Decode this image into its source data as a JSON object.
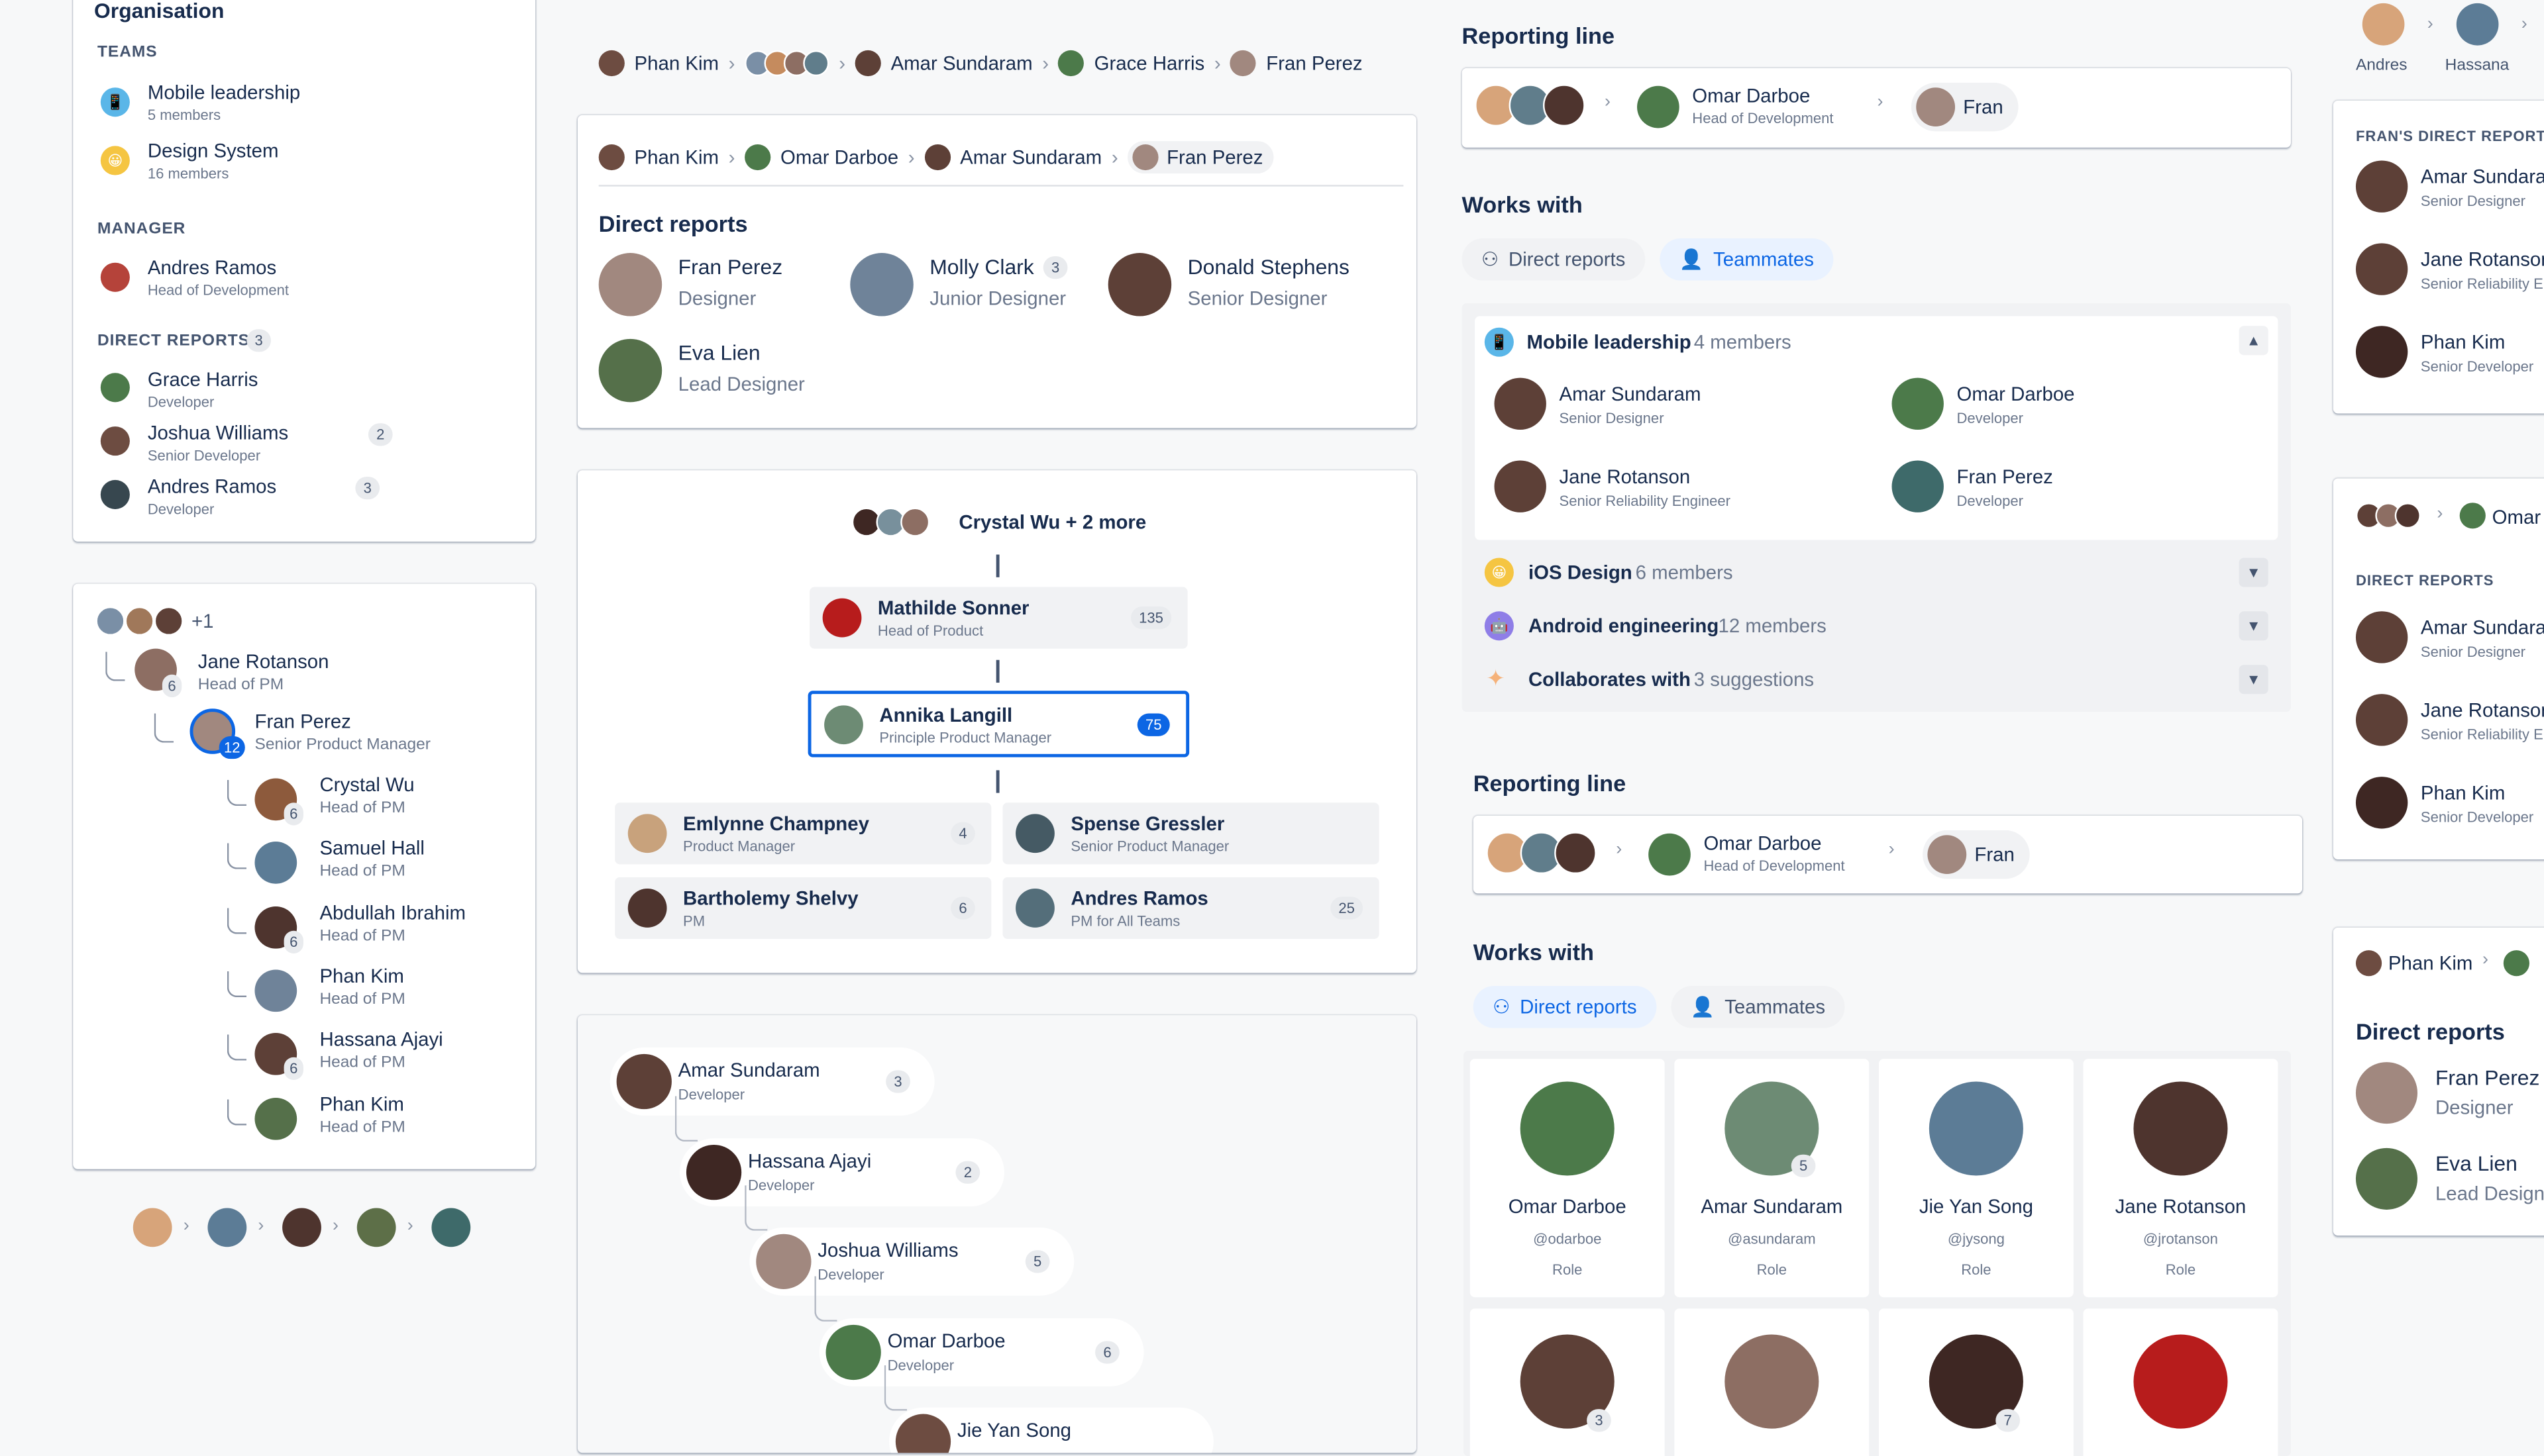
{
  "colors": {
    "accent": "#0c66e4",
    "text": "#172b4d",
    "subtle": "#6b778c"
  },
  "left_card": {
    "title": "Organisation",
    "teams_label": "TEAMS",
    "teams": [
      {
        "name": "Mobile leadership",
        "meta": "5 members"
      },
      {
        "name": "Design System",
        "meta": "16 members"
      }
    ],
    "manager_label": "MANAGER",
    "manager": {
      "name": "Andres Ramos",
      "role": "Head of Development"
    },
    "direct_reports_label": "DIRECT REPORTS",
    "direct_reports_count": "3",
    "direct_reports": [
      {
        "name": "Grace Harris",
        "role": "Developer",
        "count": ""
      },
      {
        "name": "Joshua Williams",
        "role": "Senior Developer",
        "count": "2"
      },
      {
        "name": "Andres Ramos",
        "role": "Developer",
        "count": "3"
      }
    ]
  },
  "tree_card": {
    "more": "+1",
    "root": {
      "name": "Jane Rotanson",
      "role": "Head of PM",
      "count": "6"
    },
    "sub": {
      "name": "Fran Perez",
      "role": "Senior Product Manager",
      "count": "12"
    },
    "children": [
      {
        "name": "Crystal Wu",
        "role": "Head of PM",
        "count": "6"
      },
      {
        "name": "Samuel Hall",
        "role": "Head of PM",
        "count": ""
      },
      {
        "name": "Abdullah Ibrahim",
        "role": "Head of PM",
        "count": "6"
      },
      {
        "name": "Phan Kim",
        "role": "Head of PM",
        "count": ""
      },
      {
        "name": "Hassana Ajayi",
        "role": "Head of PM",
        "count": "6"
      },
      {
        "name": "Phan Kim",
        "role": "Head of PM",
        "count": ""
      }
    ]
  },
  "top_breadcrumb": [
    "Phan Kim",
    "Amar Sundaram",
    "Grace Harris",
    "Fran Perez"
  ],
  "dr_card": {
    "breadcrumb": [
      "Phan Kim",
      "Omar Darboe",
      "Amar Sundaram",
      "Fran Perez"
    ],
    "title": "Direct reports",
    "people": [
      {
        "name": "Fran Perez",
        "role": "Designer",
        "count": ""
      },
      {
        "name": "Molly Clark",
        "role": "Junior Designer",
        "count": "3"
      },
      {
        "name": "Donald Stephens",
        "role": "Senior Designer",
        "count": ""
      },
      {
        "name": "Eva Lien",
        "role": "Lead Designer",
        "count": ""
      }
    ]
  },
  "chart_card": {
    "top": "Crystal Wu + 2 more",
    "level1": {
      "name": "Mathilde Sonner",
      "role": "Head of Product",
      "count": "135"
    },
    "level2": {
      "name": "Annika Langill",
      "role": "Principle Product Manager",
      "count": "75"
    },
    "reports": [
      {
        "name": "Emlynne Champney",
        "role": "Product Manager",
        "count": "4"
      },
      {
        "name": "Spense Gressler",
        "role": "Senior Product Manager",
        "count": ""
      },
      {
        "name": "Bartholemy Shelvy",
        "role": "PM",
        "count": "6"
      },
      {
        "name": "Andres Ramos",
        "role": "PM for All Teams",
        "count": "25"
      }
    ]
  },
  "chain_card": {
    "items": [
      {
        "name": "Amar Sundaram",
        "role": "Developer",
        "count": "3"
      },
      {
        "name": "Hassana Ajayi",
        "role": "Developer",
        "count": "2"
      },
      {
        "name": "Joshua Williams",
        "role": "Developer",
        "count": "5"
      },
      {
        "name": "Omar Darboe",
        "role": "Developer",
        "count": "6"
      },
      {
        "name": "Jie Yan Song",
        "role": "",
        "count": ""
      }
    ]
  },
  "right_top": {
    "reporting_title": "Reporting line",
    "manager": {
      "name": "Omar Darboe",
      "role": "Head of Development"
    },
    "current": "Fran",
    "works_title": "Works with",
    "tabs": [
      "Direct reports",
      "Teammates"
    ],
    "team": {
      "name": "Mobile leadership",
      "meta": "4 members"
    },
    "members": [
      {
        "name": "Amar Sundaram",
        "role": "Senior Designer"
      },
      {
        "name": "Omar Darboe",
        "role": "Developer"
      },
      {
        "name": "Jane Rotanson",
        "role": "Senior Reliability Engineer"
      },
      {
        "name": "Fran Perez",
        "role": "Developer"
      }
    ],
    "groups": [
      {
        "name": "iOS Design",
        "meta": "6 members"
      },
      {
        "name": "Android engineering",
        "meta": "12 members"
      },
      {
        "name": "Collaborates with",
        "meta": "3 suggestions"
      }
    ]
  },
  "right_bottom": {
    "reporting_title": "Reporting line",
    "manager": {
      "name": "Omar Darboe",
      "role": "Head of Development"
    },
    "current": "Fran",
    "works_title": "Works with",
    "tabs": [
      "Direct reports",
      "Teammates"
    ],
    "grid": [
      {
        "name": "Omar Darboe",
        "handle": "@odarboe",
        "role": "Role",
        "count": ""
      },
      {
        "name": "Amar Sundaram",
        "handle": "@asundaram",
        "role": "Role",
        "count": "5"
      },
      {
        "name": "Jie Yan Song",
        "handle": "@jysong",
        "role": "Role",
        "count": ""
      },
      {
        "name": "Jane Rotanson",
        "handle": "@jrotanson",
        "role": "Role",
        "count": ""
      }
    ],
    "grid_counts": [
      "3",
      "",
      "7",
      ""
    ]
  },
  "far_right": {
    "top": [
      "Andres",
      "Hassana"
    ],
    "frans_label": "FRAN'S DIRECT REPORTS",
    "list1": [
      {
        "name": "Amar Sundaram",
        "role": "Senior Designer"
      },
      {
        "name": "Jane Rotanson",
        "role": "Senior Reliability Engineer"
      },
      {
        "name": "Phan Kim",
        "role": "Senior Developer"
      }
    ],
    "mid_crumb": "Omar",
    "dr_label": "DIRECT REPORTS",
    "list2": [
      {
        "name": "Amar Sundaram",
        "role": "Senior Designer"
      },
      {
        "name": "Jane Rotanson",
        "role": "Senior Reliability Engineer"
      },
      {
        "name": "Phan Kim",
        "role": "Senior Developer"
      }
    ],
    "bottom_crumb": "Phan Kim",
    "bottom_title": "Direct reports",
    "list3": [
      {
        "name": "Fran Perez",
        "role": "Designer"
      },
      {
        "name": "Eva Lien",
        "role": "Lead Designer"
      }
    ]
  }
}
